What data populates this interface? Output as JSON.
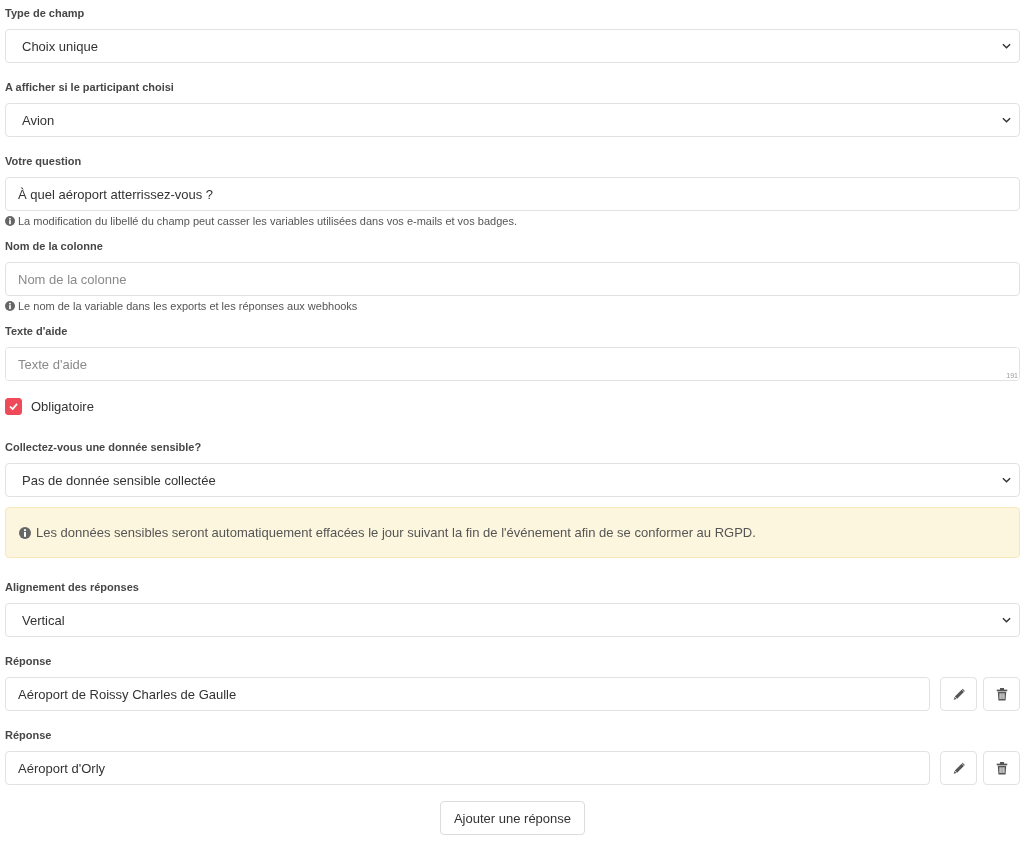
{
  "fields": [
    {
      "kind": "select",
      "label": "Type de champ",
      "value": "Choix unique"
    },
    {
      "kind": "select",
      "label": "A afficher si le participant choisi",
      "value": "Avion"
    },
    {
      "kind": "input",
      "label": "Votre question",
      "value": "À quel aéroport atterrissez-vous ?",
      "help": "La modification du libellé du champ peut casser les variables utilisées dans vos e-mails et vos badges."
    },
    {
      "kind": "input",
      "label": "Nom de la colonne",
      "placeholder": "Nom de la colonne",
      "help": "Le nom de la variable dans les exports et les réponses aux webhooks"
    },
    {
      "kind": "textarea",
      "label": "Texte d'aide",
      "placeholder": "Texte d'aide",
      "counter": "191"
    },
    {
      "kind": "checkbox",
      "label": "Obligatoire",
      "checked": true
    },
    {
      "kind": "select",
      "label": "Collectez-vous une donnée sensible?",
      "value": "Pas de donnée sensible collectée"
    },
    {
      "kind": "alert",
      "text": "Les données sensibles seront automatiquement effacées le jour suivant la fin de l'événement afin de se conformer au RGPD."
    },
    {
      "kind": "select",
      "label": "Alignement des réponses",
      "value": "Vertical"
    }
  ],
  "answers": [
    {
      "label": "Réponse",
      "value": "Aéroport de Roissy Charles de Gaulle"
    },
    {
      "label": "Réponse",
      "value": "Aéroport d'Orly"
    }
  ],
  "add_button": "Ajouter une réponse"
}
